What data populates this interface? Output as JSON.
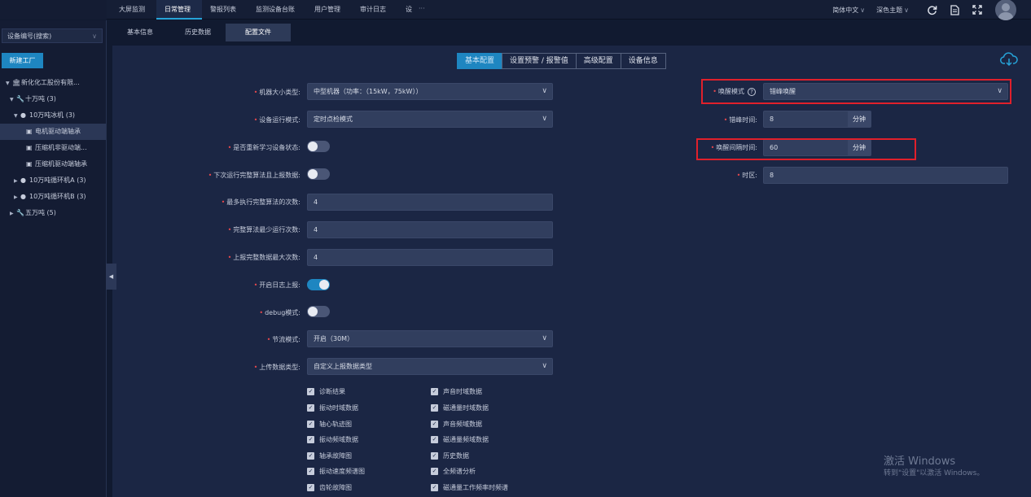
{
  "topnav": {
    "items": [
      "大屏监测",
      "日常管理",
      "警报列表",
      "监测设备台账",
      "用户管理",
      "审计日志",
      "设"
    ],
    "more": "···",
    "language": "简体中文",
    "theme": "深色主题"
  },
  "sidebar": {
    "search_placeholder": "设备编号(搜索)",
    "new_factory_label": "新建工厂",
    "tree": [
      {
        "label": "新化化工股份有限...",
        "level": 0,
        "expanded": true,
        "icon": "factory-icon"
      },
      {
        "label": "十万吨 (3)",
        "level": 1,
        "expanded": true,
        "icon": "wrench-icon"
      },
      {
        "label": "10万吨冰机 (3)",
        "level": 2,
        "expanded": true,
        "icon": "device-group-icon"
      },
      {
        "label": "电机驱动端轴承",
        "level": 3,
        "selected": true,
        "icon": "sensor-icon"
      },
      {
        "label": "压缩机非驱动端...",
        "level": 3,
        "icon": "sensor-icon"
      },
      {
        "label": "压缩机驱动端轴承",
        "level": 3,
        "icon": "sensor-icon"
      },
      {
        "label": "10万吨循环机A (3)",
        "level": 2,
        "expanded": false,
        "icon": "device-group-icon"
      },
      {
        "label": "10万吨循环机B (3)",
        "level": 2,
        "expanded": false,
        "icon": "device-group-icon"
      },
      {
        "label": "五万吨 (5)",
        "level": 1,
        "expanded": false,
        "icon": "wrench-icon"
      }
    ]
  },
  "subtabs": [
    "基本信息",
    "历史数据",
    "配置文件"
  ],
  "config_tabs": [
    "基本配置",
    "设置预警 / 报警值",
    "高级配置",
    "设备信息"
  ],
  "form_left": {
    "machine_size_label": "机器大小类型:",
    "machine_size_value": "中型机器（功率：（15kW，75kW））",
    "run_mode_label": "设备运行模式:",
    "run_mode_value": "定时点检模式",
    "relearn_label": "是否重新学习设备状态:",
    "relearn_on": false,
    "next_run_label": "下次运行完整算法且上报数据:",
    "next_run_on": false,
    "max_exec_label": "最多执行完整算法的次数:",
    "max_exec_value": "4",
    "min_run_label": "完整算法最少运行次数:",
    "min_run_value": "4",
    "max_upload_label": "上报完整数据最大次数:",
    "max_upload_value": "4",
    "log_upload_label": "开启日志上报:",
    "log_upload_on": true,
    "debug_label": "debug模式:",
    "debug_on": false,
    "power_save_label": "节流模式:",
    "power_save_value": "开启（30M）",
    "upload_type_label": "上传数据类型:",
    "upload_type_value": "自定义上报数据类型"
  },
  "checkboxes_col1": [
    "诊断结果",
    "振动时域数据",
    "轴心轨迹图",
    "振动频域数据",
    "轴承故障图",
    "振动速度频谱图",
    "齿轮故障图"
  ],
  "checkboxes_col2": [
    "声音时域数据",
    "磁通量时域数据",
    "声音频域数据",
    "磁通量频域数据",
    "历史数据",
    "全频谱分析",
    "磁通量工作频率时频谱"
  ],
  "form_right": {
    "wake_mode_label": "唤醒模式",
    "wake_mode_value": "错峰唤醒",
    "peak_time_label": "错峰时间:",
    "peak_time_value": "8",
    "peak_time_unit": "分钟",
    "wake_interval_label": "唤醒间隔时间:",
    "wake_interval_value": "60",
    "wake_interval_unit": "分钟",
    "timezone_label": "时区:",
    "timezone_value": "8"
  },
  "watermark": {
    "line1": "激活 Windows",
    "line2": "转到\"设置\"以激活 Windows。"
  },
  "colors": {
    "accent": "#1e86c1",
    "highlight": "#e0202b",
    "panel": "#1b2644",
    "background": "#111a30"
  }
}
